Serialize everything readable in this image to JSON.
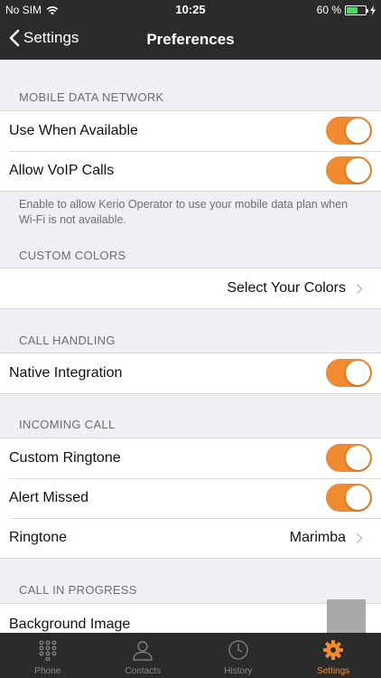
{
  "status_bar": {
    "carrier": "No SIM",
    "time": "10:25",
    "battery_pct": "60 %",
    "battery_level": 0.6
  },
  "nav": {
    "back_label": "Settings",
    "title": "Preferences"
  },
  "sections": {
    "mobile_data": {
      "header": "MOBILE DATA NETWORK",
      "use_when_available": {
        "label": "Use When Available",
        "on": true
      },
      "allow_voip": {
        "label": "Allow VoIP Calls",
        "on": true
      },
      "footer": "Enable to allow Kerio Operator to use your mobile data plan when Wi-Fi is not available."
    },
    "custom_colors": {
      "header": "CUSTOM COLORS",
      "select_label": "Select Your Colors"
    },
    "call_handling": {
      "header": "CALL HANDLING",
      "native_integration": {
        "label": "Native Integration",
        "on": true
      }
    },
    "incoming_call": {
      "header": "INCOMING CALL",
      "custom_ringtone": {
        "label": "Custom Ringtone",
        "on": true
      },
      "alert_missed": {
        "label": "Alert Missed",
        "on": true
      },
      "ringtone": {
        "label": "Ringtone",
        "value": "Marimba"
      }
    },
    "call_in_progress": {
      "header": "CALL IN PROGRESS",
      "background_image": {
        "label": "Background Image"
      }
    }
  },
  "tabs": [
    {
      "label": "Phone",
      "icon": "keypad-icon"
    },
    {
      "label": "Contacts",
      "icon": "person-icon"
    },
    {
      "label": "History",
      "icon": "clock-icon"
    },
    {
      "label": "Settings",
      "icon": "gear-icon",
      "active": true
    }
  ],
  "colors": {
    "accent": "#f28a30",
    "bar": "#2b2b2b",
    "background": "#efeff4"
  }
}
